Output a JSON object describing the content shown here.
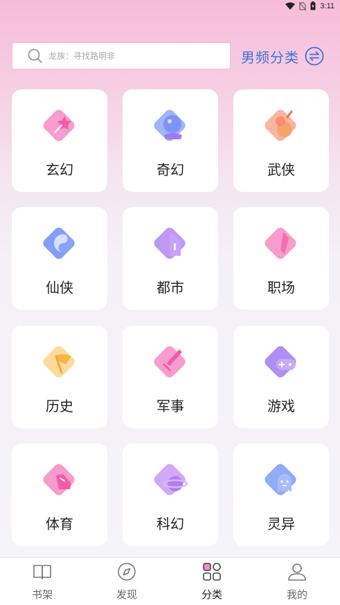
{
  "status_bar": {
    "time": "3:11"
  },
  "search": {
    "placeholder": "龙族：寻找路明非"
  },
  "channel": {
    "label": "男频分类"
  },
  "categories": [
    {
      "label": "玄幻",
      "icon": "wand-icon"
    },
    {
      "label": "奇幻",
      "icon": "crystal-ball-icon"
    },
    {
      "label": "武侠",
      "icon": "gourd-icon"
    },
    {
      "label": "仙侠",
      "icon": "yin-yang-icon"
    },
    {
      "label": "都市",
      "icon": "building-icon"
    },
    {
      "label": "职场",
      "icon": "tie-icon"
    },
    {
      "label": "历史",
      "icon": "flag-icon"
    },
    {
      "label": "军事",
      "icon": "sword-icon"
    },
    {
      "label": "游戏",
      "icon": "gamepad-icon"
    },
    {
      "label": "体育",
      "icon": "shoe-icon"
    },
    {
      "label": "科幻",
      "icon": "planet-icon"
    },
    {
      "label": "灵异",
      "icon": "ghost-icon"
    }
  ],
  "nav": {
    "items": [
      {
        "label": "书架",
        "icon": "book-icon"
      },
      {
        "label": "发现",
        "icon": "compass-icon"
      },
      {
        "label": "分类",
        "icon": "grid-icon"
      },
      {
        "label": "我的",
        "icon": "user-icon"
      }
    ],
    "active_index": 2
  },
  "colors": {
    "accent": "#3d73d8",
    "pink": "#f26fb0",
    "purple": "#9a6ff0",
    "blue": "#5b86f5",
    "orange": "#f5a36d",
    "yellow": "#f8c45a"
  }
}
